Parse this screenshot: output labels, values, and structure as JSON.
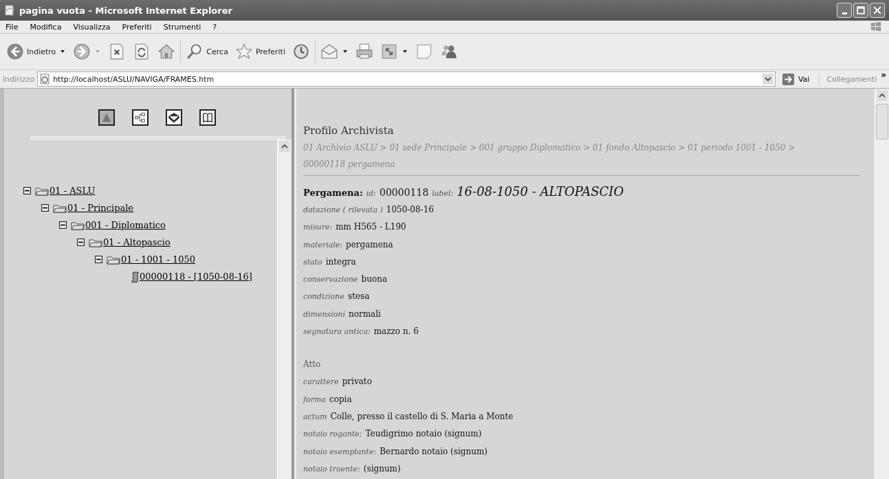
{
  "window": {
    "title": "pagina vuota - Microsoft Internet Explorer"
  },
  "menu": [
    "File",
    "Modifica",
    "Visualizza",
    "Preferiti",
    "Strumenti",
    "?"
  ],
  "toolbar": [
    {
      "kind": "back",
      "label": "Indietro",
      "dropdown": true
    },
    {
      "kind": "forward",
      "dropdown": true
    },
    {
      "kind": "stop"
    },
    {
      "kind": "refresh"
    },
    {
      "kind": "home"
    },
    {
      "kind": "search",
      "label": "Cerca"
    },
    {
      "kind": "favorites",
      "label": "Preferiti"
    },
    {
      "kind": "history"
    },
    {
      "kind": "mail",
      "dropdown": true
    },
    {
      "kind": "print"
    },
    {
      "kind": "edit",
      "dropdown": true
    },
    {
      "kind": "note"
    },
    {
      "kind": "messenger"
    }
  ],
  "address": {
    "label": "Indirizzo",
    "value": "http://localhost/ASLU/NAVIGA/FRAMES.htm",
    "go": "Vai",
    "links": "Collegamenti",
    "more": "»"
  },
  "nav_buttons": [
    {
      "kind": "pyramid",
      "selected": true
    },
    {
      "kind": "tree",
      "selected": false
    },
    {
      "kind": "book",
      "selected": false
    },
    {
      "kind": "open-book",
      "selected": false
    }
  ],
  "tree": [
    {
      "label": "01 - ASLU",
      "kind": "folder",
      "expanded": true,
      "children": [
        {
          "label": "01 - Principale",
          "kind": "folder",
          "expanded": true,
          "children": [
            {
              "label": "001 - Diplomatico",
              "kind": "folder",
              "expanded": true,
              "children": [
                {
                  "label": "01 - Altopascio",
                  "kind": "folder",
                  "expanded": true,
                  "children": [
                    {
                      "label": "01 - 1001 - 1050",
                      "kind": "folder",
                      "expanded": true,
                      "children": [
                        {
                          "label": "00000118 - [1050-08-16]",
                          "kind": "document"
                        }
                      ]
                    }
                  ]
                }
              ]
            }
          ]
        }
      ]
    }
  ],
  "content": {
    "title": "Profilo Archivista",
    "breadcrumb": "01 Archivio ASLU > 01 sede Principale > 001 gruppo Diplomatico > 01 fondo Altopascio > 01 periodo 1001 - 1050 > 00000118 pergamena",
    "record": {
      "type": "Pergamena:",
      "id_label": "id:",
      "id": "00000118",
      "label_label": "label:",
      "label": "16-08-1050 - ALTOPASCIO"
    },
    "fields": [
      {
        "label": "datazione ( rilevata )",
        "value": "1050-08-16"
      },
      {
        "label": "misure:",
        "value": "mm H565 - L190"
      },
      {
        "label": "materiale:",
        "value": "pergamena"
      },
      {
        "label": "stato",
        "value": "integra"
      },
      {
        "label": "conservazione",
        "value": "buona"
      },
      {
        "label": "condizione",
        "value": "stesa"
      },
      {
        "label": "dimensioni",
        "value": "normali"
      },
      {
        "label": "segnatura antica:",
        "value": "mazzo n. 6"
      }
    ],
    "section": "Atto",
    "act_fields": [
      {
        "label": "carattere",
        "value": "privato"
      },
      {
        "label": "forma",
        "value": "copia"
      },
      {
        "label": "actum",
        "value": "Colle, presso il castello di S. Maria a Monte"
      },
      {
        "label": "notaio rogante:",
        "value": "Teudigrimo notaio (signum)"
      },
      {
        "label": "notaio esemplante:",
        "value": "Bernardo notaio (signum)"
      },
      {
        "label": "notaio traente:",
        "value": "(signum)"
      }
    ]
  }
}
